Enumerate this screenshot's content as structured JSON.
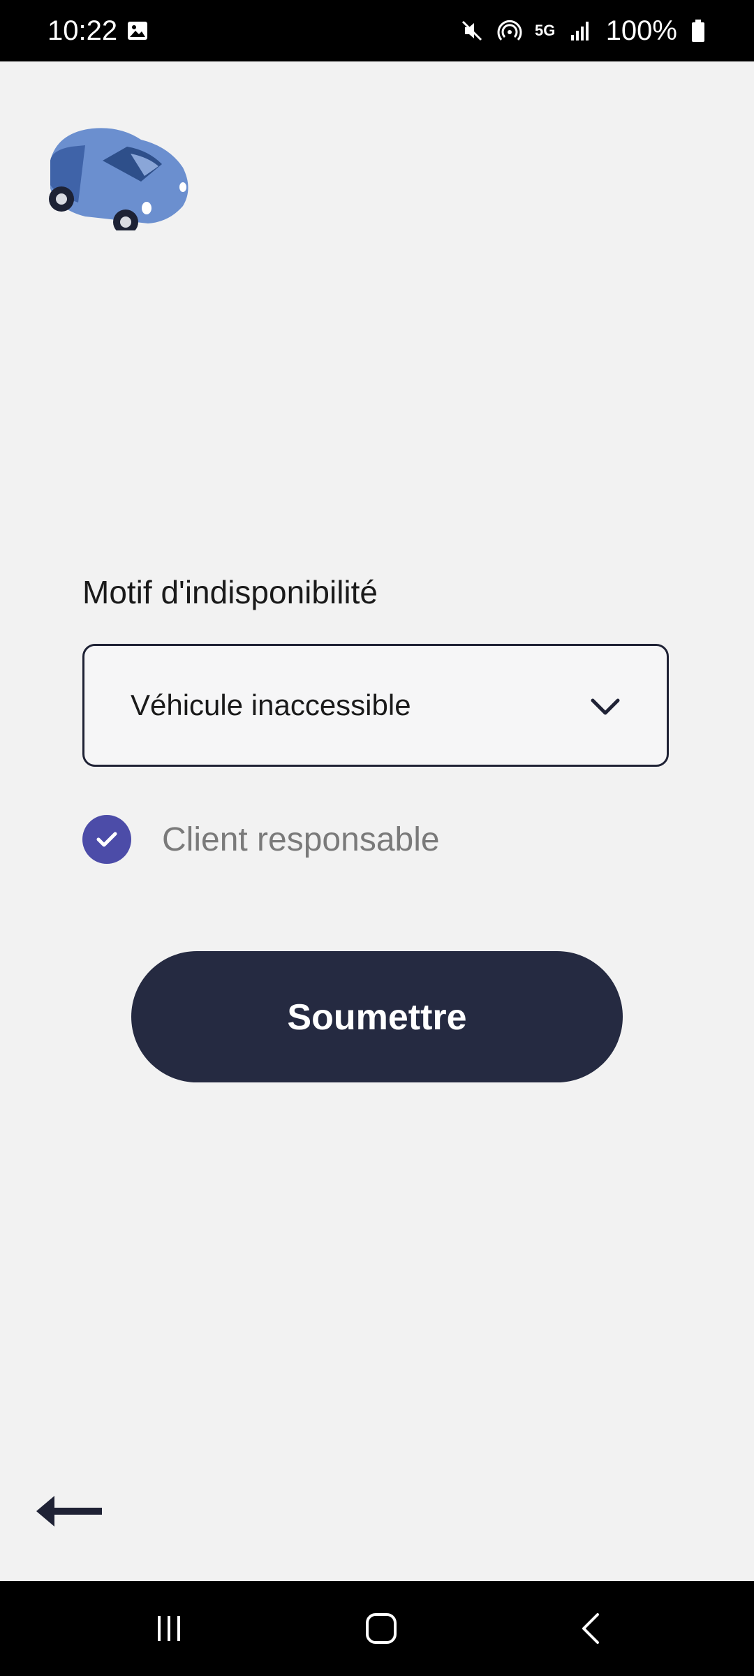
{
  "status_bar": {
    "time": "10:22",
    "network": "5G",
    "battery": "100%",
    "icons": [
      "gallery-icon",
      "mute-icon",
      "hotspot-icon",
      "signal-icon",
      "battery-icon"
    ]
  },
  "app": {
    "logo": "car-icon",
    "form": {
      "label": "Motif d'indisponibilité",
      "dropdown_value": "Véhicule inaccessible",
      "checkbox_label": "Client responsable",
      "checkbox_checked": true,
      "submit_label": "Soumettre"
    },
    "back_icon": "back-arrow-icon"
  },
  "colors": {
    "background": "#f2f2f2",
    "primary_dark": "#252a41",
    "checkbox_accent": "#4c4ca8",
    "muted_text": "#7a7a7a"
  },
  "nav_bar": {
    "items": [
      "recent-apps-icon",
      "home-icon",
      "back-icon"
    ]
  }
}
